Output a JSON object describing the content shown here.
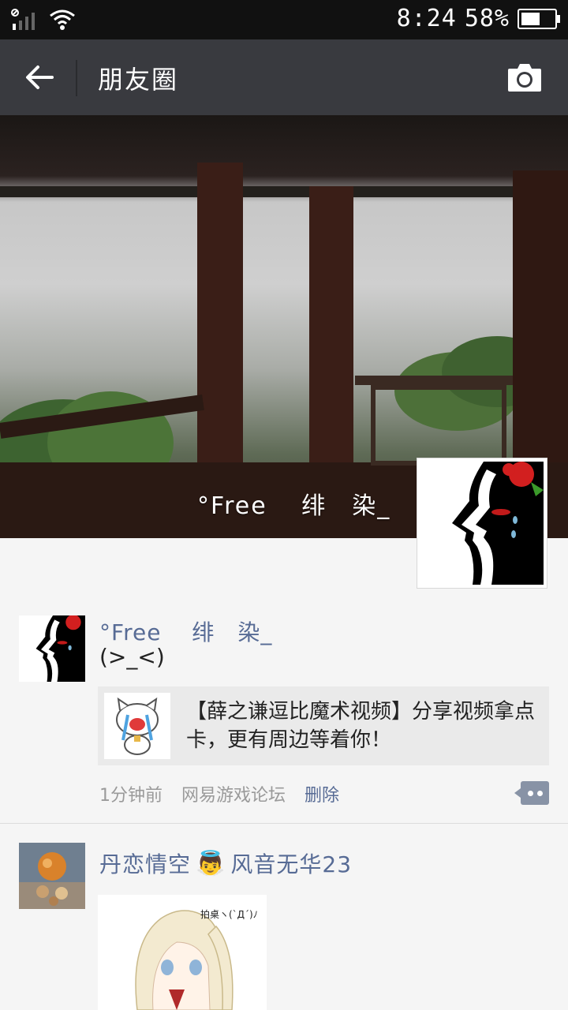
{
  "status": {
    "time": "8:24",
    "battery": "58%",
    "battery_level": 0.58
  },
  "header": {
    "title": "朋友圈"
  },
  "cover": {
    "name": "°Free　 绯　染_"
  },
  "posts": [
    {
      "name": "°Free　 绯　染_",
      "text": "(>_<)",
      "share": {
        "title": "【薛之谦逗比魔术视频】分享视频拿点卡，更有周边等着你！"
      },
      "time": "1分钟前",
      "source": "网易游戏论坛",
      "delete": "删除"
    },
    {
      "name": "丹恋情空",
      "name_suffix": "风音无华23",
      "emoji": "👼",
      "image_caption": "拍桌ヽ(`Д´)ﾉ"
    }
  ]
}
